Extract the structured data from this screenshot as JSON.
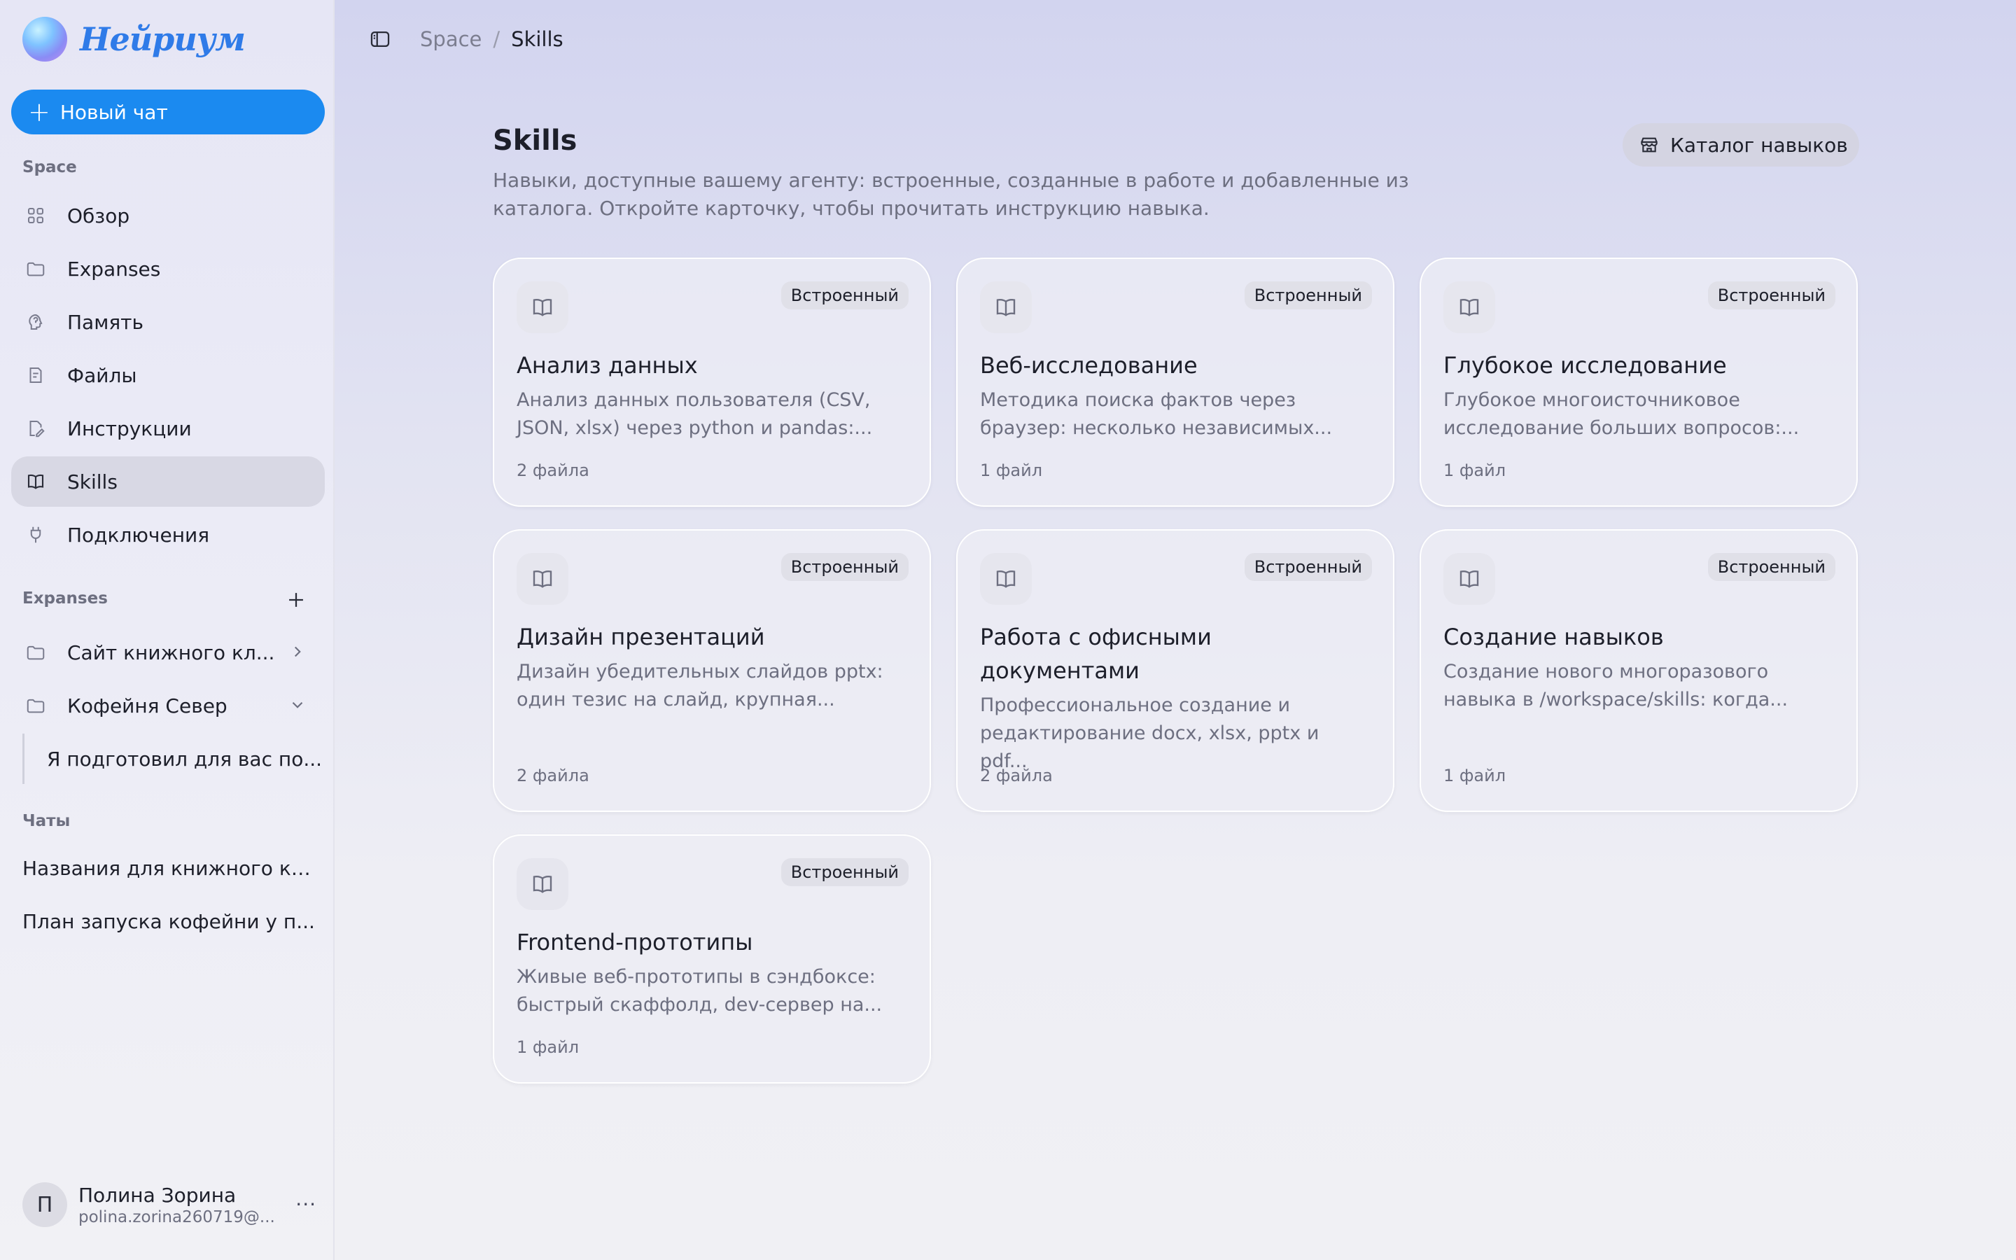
{
  "app": {
    "logo_text": "Нейриум"
  },
  "sidebar": {
    "new_chat_label": "Новый чат",
    "space_label": "Space",
    "nav": [
      {
        "label": "Обзор",
        "icon": "grid-icon"
      },
      {
        "label": "Expanses",
        "icon": "folder-icon"
      },
      {
        "label": "Память",
        "icon": "brain-icon"
      },
      {
        "label": "Файлы",
        "icon": "file-icon"
      },
      {
        "label": "Инструкции",
        "icon": "edit-document-icon"
      },
      {
        "label": "Skills",
        "icon": "book-icon",
        "active": true
      },
      {
        "label": "Подключения",
        "icon": "plug-icon"
      }
    ],
    "expanses_label": "Expanses",
    "expanses": [
      {
        "label": "Сайт книжного кл...",
        "icon": "folder-icon",
        "chevron": "chevron-right-icon"
      },
      {
        "label": "Кофейня Север",
        "icon": "folder-icon",
        "chevron": "chevron-down-icon"
      }
    ],
    "expanse_child": "Я подготовил для вас по...",
    "chats_label": "Чаты",
    "chats": [
      "Названия для книжного кл...",
      "План запуска кофейни у п..."
    ],
    "user": {
      "initial": "П",
      "name": "Полина Зорина",
      "email": "polina.zorina260719@...",
      "more": "···"
    }
  },
  "breadcrumb": {
    "parent": "Space",
    "separator": "/",
    "current": "Skills"
  },
  "page": {
    "title": "Skills",
    "description": "Навыки, доступные вашему агенту: встроенные, созданные в работе и добавленные из каталога. Откройте карточку, чтобы прочитать инструкцию навыка.",
    "catalog_button": "Каталог навыков"
  },
  "skills": [
    {
      "title": "Анализ данных",
      "badge": "Встроенный",
      "desc": "Анализ данных пользователя (CSV, JSON, xlsx) через python и pandas:...",
      "files": "2 файла"
    },
    {
      "title": "Веб-исследование",
      "badge": "Встроенный",
      "desc": "Методика поиска фактов через браузер: несколько независимых...",
      "files": "1 файл"
    },
    {
      "title": "Глубокое исследование",
      "badge": "Встроенный",
      "desc": "Глубокое многоисточниковое исследование больших вопросов:...",
      "files": "1 файл"
    },
    {
      "title": "Дизайн презентаций",
      "badge": "Встроенный",
      "desc": "Дизайн убедительных слайдов pptx: один тезис на слайд, крупная...",
      "files": "2 файла"
    },
    {
      "title": "Работа с офисными документами",
      "badge": "Встроенный",
      "desc": "Профессиональное создание и редактирование docx, xlsx, pptx и pdf...",
      "files": "2 файла"
    },
    {
      "title": "Создание навыков",
      "badge": "Встроенный",
      "desc": "Создание нового многоразового навыка в /workspace/skills: когда...",
      "files": "1 файл"
    },
    {
      "title": "Frontend-прототипы",
      "badge": "Встроенный",
      "desc": "Живые веб-прототипы в сэндбоксе: быстрый скаффолд, dev-сервер на...",
      "files": "1 файл"
    }
  ]
}
